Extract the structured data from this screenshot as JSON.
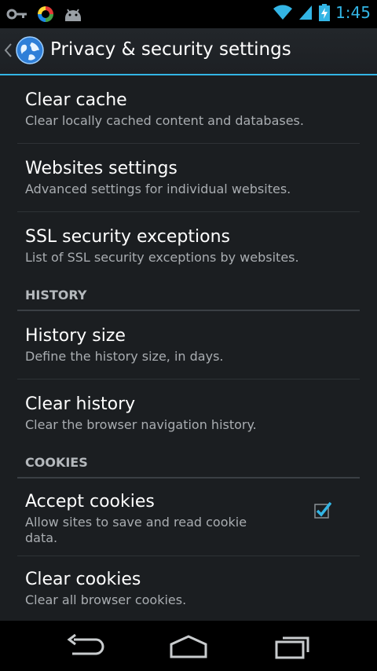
{
  "status": {
    "time": "1:45"
  },
  "action_bar": {
    "title": "Privacy & security settings"
  },
  "sections": {
    "general": [
      {
        "title": "Clear cache",
        "summary": "Clear locally cached content and databases."
      },
      {
        "title": "Websites settings",
        "summary": "Advanced settings for individual websites."
      },
      {
        "title": "SSL security exceptions",
        "summary": "List of SSL security exceptions by websites."
      }
    ],
    "history_header": "HISTORY",
    "history": [
      {
        "title": "History size",
        "summary": "Define the history size, in days."
      },
      {
        "title": "Clear history",
        "summary": "Clear the browser navigation history."
      }
    ],
    "cookies_header": "COOKIES",
    "cookies": [
      {
        "title": "Accept cookies",
        "summary": "Allow sites to save and read cookie data.",
        "checked": true
      },
      {
        "title": "Clear cookies",
        "summary": "Clear all browser cookies."
      }
    ]
  },
  "colors": {
    "accent": "#33b5e5",
    "background": "#1b1e21"
  }
}
